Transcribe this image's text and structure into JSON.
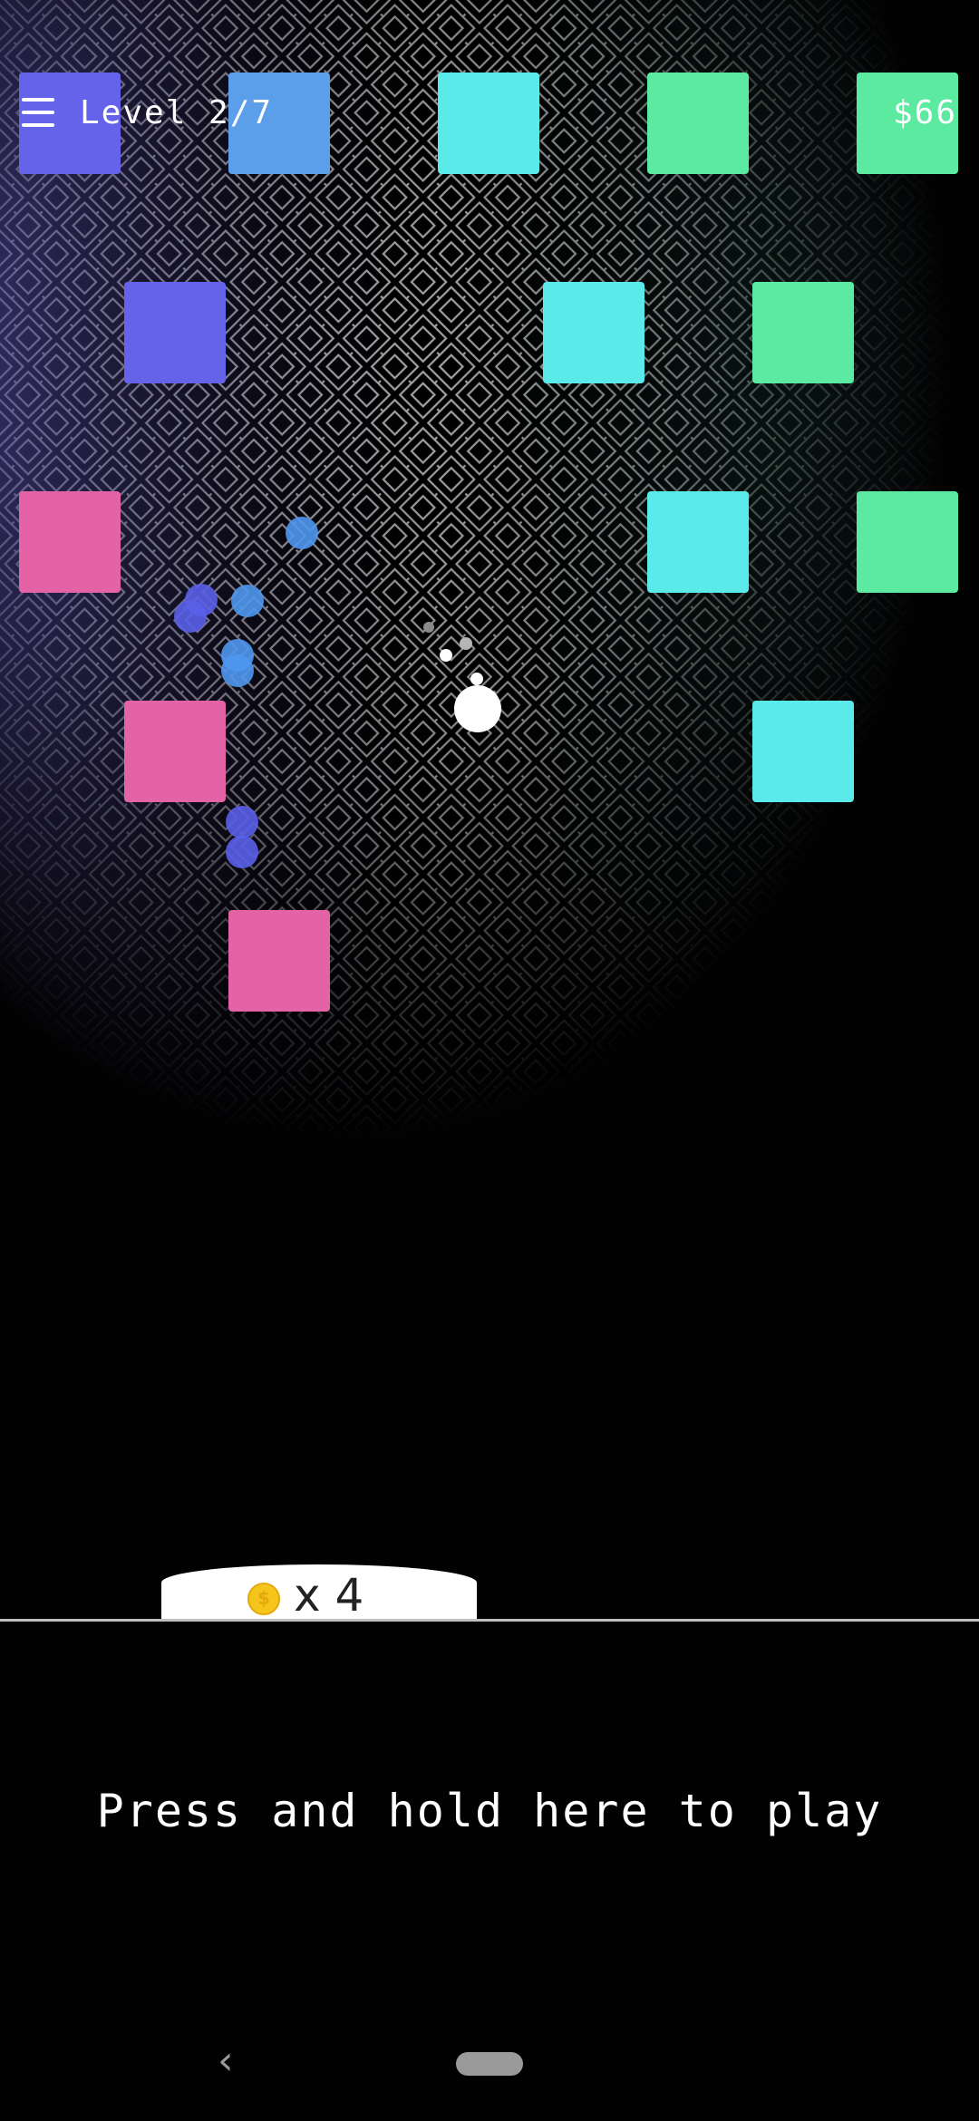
{
  "hud": {
    "level_label": "Level 2/7",
    "money": "$66"
  },
  "launcher": {
    "ball_count": "x 4",
    "coin_symbol": "$"
  },
  "play_prompt": "Press and hold here to play",
  "colors": {
    "indigo": "#6463e9",
    "blue": "#5b9ee9",
    "cyan": "#5beaea",
    "green": "#5beaa0",
    "pink": "#e463a6",
    "ball_blue": "#4f97ee",
    "ball_indigo": "#5a5fe8"
  },
  "icons": {
    "menu": "hamburger-menu-icon",
    "coin": "coin-icon",
    "back": "back-chevron-icon",
    "home": "home-pill-icon"
  },
  "blocks": [
    {
      "row": 0,
      "col": 0,
      "color": "indigo"
    },
    {
      "row": 0,
      "col": 2,
      "color": "blue"
    },
    {
      "row": 0,
      "col": 4,
      "color": "cyan"
    },
    {
      "row": 0,
      "col": 6,
      "color": "green"
    },
    {
      "row": 0,
      "col": 8,
      "color": "green"
    },
    {
      "row": 1,
      "col": 1,
      "color": "indigo"
    },
    {
      "row": 1,
      "col": 5,
      "color": "cyan"
    },
    {
      "row": 1,
      "col": 7,
      "color": "green"
    },
    {
      "row": 2,
      "col": 0,
      "color": "pink"
    },
    {
      "row": 2,
      "col": 6,
      "color": "cyan"
    },
    {
      "row": 2,
      "col": 8,
      "color": "green"
    },
    {
      "row": 3,
      "col": 1,
      "color": "pink"
    },
    {
      "row": 3,
      "col": 7,
      "color": "cyan"
    },
    {
      "row": 4,
      "col": 2,
      "color": "pink"
    }
  ]
}
